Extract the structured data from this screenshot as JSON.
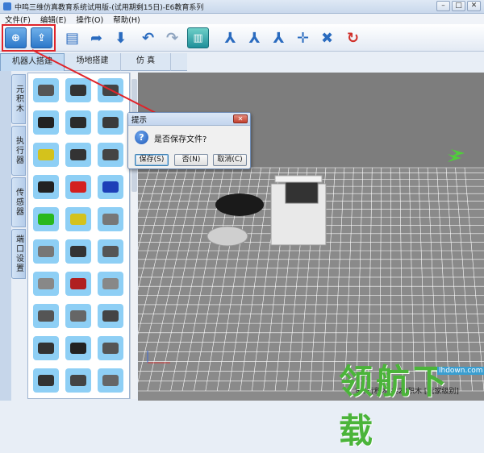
{
  "window": {
    "title": "中鸣三维仿真教育系统试用版-(试用期剩15日)-E6教育系列",
    "min_label": "–",
    "max_label": "□",
    "close_label": "✕"
  },
  "menu": [
    "文件(F)",
    "编辑(E)",
    "操作(O)",
    "帮助(H)"
  ],
  "toolbar": {
    "buttons": [
      {
        "name": "new-file",
        "icon": "new-doc-icon",
        "glyph": "⊕"
      },
      {
        "name": "open-file",
        "icon": "open-folder-icon",
        "glyph": "⇪"
      },
      {
        "name": "save-file",
        "icon": "save-icon",
        "glyph": "▤"
      },
      {
        "name": "export",
        "icon": "export-icon",
        "glyph": "➦"
      },
      {
        "name": "import",
        "icon": "import-icon",
        "glyph": "⬇"
      },
      {
        "name": "undo",
        "icon": "undo-icon",
        "glyph": "↶"
      },
      {
        "name": "redo",
        "icon": "redo-icon",
        "glyph": "↷"
      },
      {
        "name": "assemble",
        "icon": "assemble-icon",
        "glyph": "▥"
      },
      {
        "name": "axis-1",
        "icon": "axis-icon",
        "glyph": "⅄"
      },
      {
        "name": "axis-2",
        "icon": "axis-icon",
        "glyph": "⅄"
      },
      {
        "name": "axis-3",
        "icon": "axis-icon",
        "glyph": "⅄"
      },
      {
        "name": "move",
        "icon": "move-icon",
        "glyph": "✛"
      },
      {
        "name": "delete",
        "icon": "delete-icon",
        "glyph": "✖"
      },
      {
        "name": "run",
        "icon": "run-icon",
        "glyph": "↻"
      }
    ]
  },
  "tabs": [
    "机器人搭建",
    "场地搭建",
    "仿 真"
  ],
  "side_tabs": [
    "元积木",
    "执行器",
    "传感器",
    "端口设置"
  ],
  "dialog": {
    "title": "提示",
    "message": "是否保存文件?",
    "buttons": [
      "保存(S)",
      "否(N)",
      "取消(C)"
    ]
  },
  "status_text": "第6行积木,共20积木 [玩家级别]",
  "watermark": {
    "text": "领航下载",
    "url": "lhdown.com"
  },
  "colors": {
    "accent": "#2c77c9",
    "highlight_box": "#e0242a",
    "part_bg": "#8ecff5",
    "grid": "#ffffff",
    "watermark": "#4bb43a"
  }
}
